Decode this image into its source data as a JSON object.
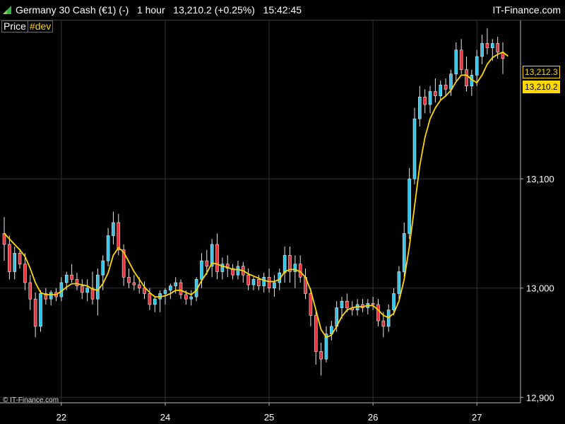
{
  "header": {
    "title": "Germany 30 Cash (€1) (-)   1 hour   13,210.2 (+0.25%)   15:42:45",
    "brand": "IT-Finance.com"
  },
  "legend": {
    "price": "Price",
    "dev": "#dev"
  },
  "copyright": "© IT-Finance.com",
  "colors": {
    "up": "#2ec6ec",
    "down": "#e8323c",
    "ma": "#ffd800",
    "grid": "#333333",
    "background": "#000000"
  },
  "chart_data": {
    "type": "candlestick",
    "yticks": [
      12900,
      13000,
      13100
    ],
    "ytick_labels": [
      "12,900",
      "13,000",
      "13,100"
    ],
    "xticks": [
      {
        "label": "22",
        "bar": 11
      },
      {
        "label": "24",
        "bar": 31
      },
      {
        "label": "25",
        "bar": 51
      },
      {
        "label": "26",
        "bar": 71
      },
      {
        "label": "27",
        "bar": 91
      }
    ],
    "ylim": [
      12895,
      13245
    ],
    "last_price": 13210.2,
    "last_price_label": "13,210.2",
    "ma_value": 13212.3,
    "ma_label": "13,212.3",
    "ohlc": [
      [
        13050,
        13065,
        13025,
        13040
      ],
      [
        13040,
        13048,
        13008,
        13015
      ],
      [
        13015,
        13038,
        13008,
        13032
      ],
      [
        13032,
        13036,
        13018,
        13022
      ],
      [
        13022,
        13032,
        12998,
        13005
      ],
      [
        13005,
        13012,
        12980,
        12990
      ],
      [
        12990,
        12996,
        12955,
        12965
      ],
      [
        12965,
        12998,
        12960,
        12995
      ],
      [
        12995,
        13000,
        12985,
        12990
      ],
      [
        12990,
        12998,
        12984,
        12996
      ],
      [
        12996,
        13000,
        12988,
        12992
      ],
      [
        12992,
        13010,
        12988,
        13005
      ],
      [
        13005,
        13015,
        12998,
        13012
      ],
      [
        13012,
        13022,
        13005,
        13008
      ],
      [
        13008,
        13014,
        12998,
        13002
      ],
      [
        13002,
        13008,
        12990,
        12996
      ],
      [
        12996,
        13008,
        12988,
        13000
      ],
      [
        13000,
        13015,
        12985,
        12990
      ],
      [
        12990,
        13018,
        12975,
        13012
      ],
      [
        13012,
        13030,
        12998,
        13025
      ],
      [
        13025,
        13055,
        13020,
        13048
      ],
      [
        13048,
        13070,
        13040,
        13060
      ],
      [
        13060,
        13068,
        13030,
        13035
      ],
      [
        13035,
        13040,
        13002,
        13010
      ],
      [
        13010,
        13018,
        13000,
        13005
      ],
      [
        13005,
        13012,
        12998,
        13003
      ],
      [
        13003,
        13010,
        12995,
        13000
      ],
      [
        13000,
        13006,
        12990,
        12995
      ],
      [
        12995,
        13000,
        12980,
        12985
      ],
      [
        12985,
        12992,
        12978,
        12990
      ],
      [
        12990,
        12998,
        12978,
        12995
      ],
      [
        12995,
        13000,
        12985,
        12998
      ],
      [
        12998,
        13004,
        12990,
        13002
      ],
      [
        13002,
        13010,
        12995,
        13005
      ],
      [
        13005,
        13008,
        12990,
        12994
      ],
      [
        12994,
        12998,
        12985,
        12990
      ],
      [
        12990,
        12998,
        12984,
        12992
      ],
      [
        12992,
        13010,
        12988,
        13008
      ],
      [
        13008,
        13032,
        13000,
        13025
      ],
      [
        13025,
        13035,
        13012,
        13020
      ],
      [
        13020,
        13045,
        13010,
        13040
      ],
      [
        13040,
        13050,
        13008,
        13015
      ],
      [
        13015,
        13028,
        13008,
        13022
      ],
      [
        13022,
        13030,
        13010,
        13018
      ],
      [
        13018,
        13022,
        13008,
        13012
      ],
      [
        13012,
        13025,
        13008,
        13020
      ],
      [
        13020,
        13024,
        13005,
        13012
      ],
      [
        13012,
        13018,
        12998,
        13003
      ],
      [
        13003,
        13010,
        12998,
        13008
      ],
      [
        13008,
        13012,
        12998,
        13002
      ],
      [
        13002,
        13014,
        12996,
        13010
      ],
      [
        13010,
        13018,
        12996,
        13000
      ],
      [
        13000,
        13012,
        12992,
        13005
      ],
      [
        13005,
        13018,
        12998,
        13014
      ],
      [
        13014,
        13038,
        13005,
        13030
      ],
      [
        13030,
        13038,
        13005,
        13015
      ],
      [
        13015,
        13030,
        13000,
        13022
      ],
      [
        13022,
        13030,
        13005,
        13010
      ],
      [
        13010,
        13018,
        12990,
        12995
      ],
      [
        12995,
        13000,
        12965,
        12975
      ],
      [
        12975,
        12980,
        12930,
        12942
      ],
      [
        12942,
        12950,
        12920,
        12935
      ],
      [
        12935,
        12965,
        12932,
        12958
      ],
      [
        12958,
        12970,
        12952,
        12965
      ],
      [
        12965,
        12988,
        12960,
        12982
      ],
      [
        12982,
        12992,
        12972,
        12988
      ],
      [
        12988,
        12995,
        12978,
        12982
      ],
      [
        12982,
        12988,
        12975,
        12980
      ],
      [
        12980,
        12990,
        12975,
        12985
      ],
      [
        12985,
        12990,
        12978,
        12982
      ],
      [
        12982,
        12990,
        12976,
        12986
      ],
      [
        12986,
        12992,
        12980,
        12985
      ],
      [
        12985,
        12990,
        12965,
        12970
      ],
      [
        12970,
        12978,
        12955,
        12965
      ],
      [
        12965,
        12985,
        12960,
        12980
      ],
      [
        12980,
        13000,
        12975,
        12995
      ],
      [
        12995,
        13020,
        12990,
        13015
      ],
      [
        13015,
        13060,
        13010,
        13050
      ],
      [
        13050,
        13110,
        13045,
        13100
      ],
      [
        13100,
        13165,
        13095,
        13155
      ],
      [
        13155,
        13185,
        13148,
        13175
      ],
      [
        13175,
        13182,
        13160,
        13168
      ],
      [
        13168,
        13185,
        13160,
        13180
      ],
      [
        13180,
        13192,
        13170,
        13176
      ],
      [
        13176,
        13190,
        13172,
        13186
      ],
      [
        13186,
        13192,
        13175,
        13182
      ],
      [
        13182,
        13200,
        13176,
        13196
      ],
      [
        13196,
        13225,
        13190,
        13218
      ],
      [
        13218,
        13228,
        13196,
        13200
      ],
      [
        13200,
        13212,
        13180,
        13185
      ],
      [
        13185,
        13200,
        13176,
        13195
      ],
      [
        13195,
        13218,
        13185,
        13212
      ],
      [
        13212,
        13232,
        13205,
        13224
      ],
      [
        13224,
        13238,
        13214,
        13220
      ],
      [
        13220,
        13228,
        13208,
        13224
      ],
      [
        13224,
        13230,
        13210,
        13216
      ],
      [
        13216,
        13225,
        13196,
        13210.2
      ]
    ],
    "ma": [
      13050,
      13045,
      13040,
      13035,
      13029,
      13018,
      13005,
      12996,
      12994,
      12994,
      12994,
      12997,
      13001,
      13004,
      13004,
      13003,
      13002,
      12999,
      12998,
      13004,
      13014,
      13030,
      13037,
      13033,
      13024,
      13015,
      13008,
      13001,
      12996,
      12992,
      12992,
      12993,
      12995,
      12998,
      12998,
      12996,
      12994,
      12998,
      13007,
      13014,
      13023,
      13022,
      13020,
      13019,
      13017,
      13017,
      13016,
      13013,
      13011,
      13009,
      13007,
      13006,
      13006,
      13008,
      13015,
      13017,
      13017,
      13015,
      13010,
      12998,
      12980,
      12962,
      12955,
      12957,
      12965,
      12974,
      12980,
      12982,
      12983,
      12983,
      12984,
      12984,
      12980,
      12975,
      12973,
      12977,
      12988,
      13008,
      13038,
      13075,
      13112,
      13138,
      13155,
      13165,
      13172,
      13176,
      13181,
      13189,
      13195,
      13195,
      13191,
      13188,
      13195,
      13205,
      13211,
      13214,
      13216,
      13212.3
    ]
  }
}
